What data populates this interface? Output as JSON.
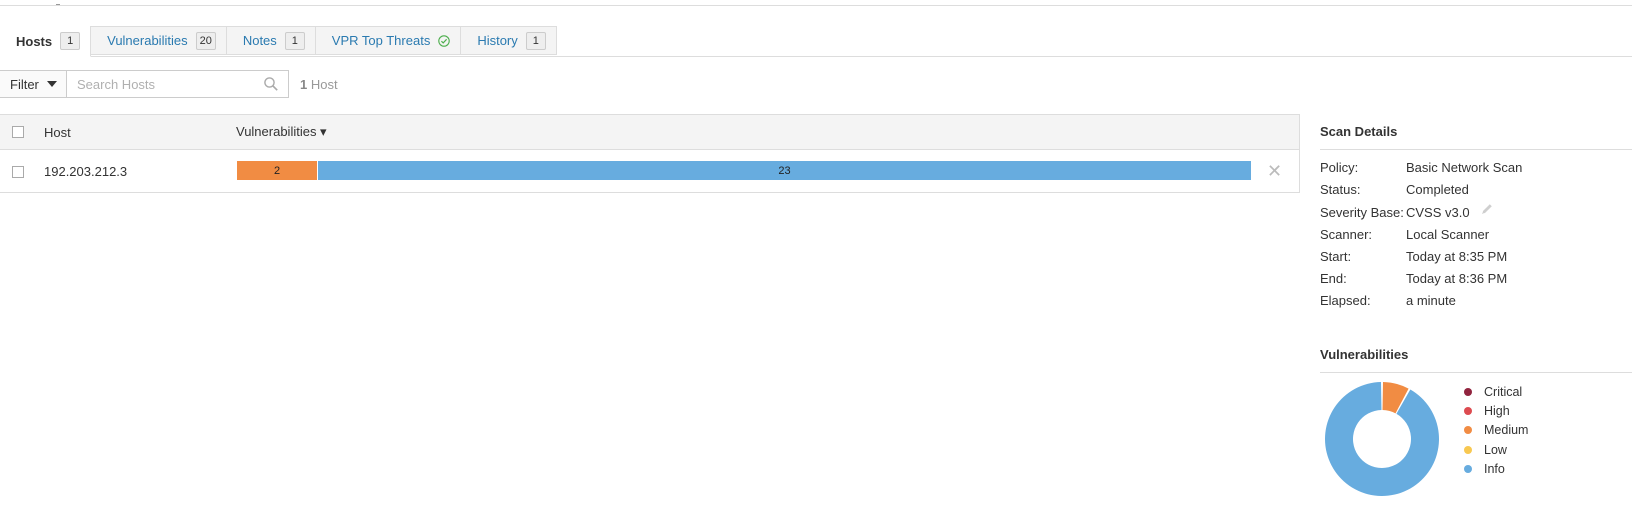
{
  "tabs": [
    {
      "label": "Hosts",
      "badge": "1",
      "active": true
    },
    {
      "label": "Vulnerabilities",
      "badge": "20"
    },
    {
      "label": "Notes",
      "badge": "1"
    },
    {
      "label": "VPR Top Threats",
      "icon": "check-circle-icon"
    },
    {
      "label": "History",
      "badge": "1"
    }
  ],
  "filter": {
    "button_label": "Filter",
    "search_placeholder": "Search Hosts",
    "count_number": "1",
    "count_label": "Host"
  },
  "table": {
    "columns": {
      "host": "Host",
      "vulnerabilities": "Vulnerabilities ▾"
    },
    "rows": [
      {
        "host": "192.203.212.3",
        "medium": 2,
        "info": 23,
        "medium_label": "2",
        "info_label": "23"
      }
    ]
  },
  "scan_details": {
    "title": "Scan Details",
    "items": [
      {
        "key": "Policy:",
        "value": "Basic Network Scan"
      },
      {
        "key": "Status:",
        "value": "Completed"
      },
      {
        "key": "Severity Base:",
        "value": "CVSS v3.0"
      },
      {
        "key": "Scanner:",
        "value": "Local Scanner"
      },
      {
        "key": "Start:",
        "value": "Today at 8:35 PM"
      },
      {
        "key": "End:",
        "value": "Today at 8:36 PM"
      },
      {
        "key": "Elapsed:",
        "value": "a minute"
      }
    ]
  },
  "vulnerabilities_panel": {
    "title": "Vulnerabilities",
    "legend": [
      {
        "label": "Critical",
        "color": "#91243e"
      },
      {
        "label": "High",
        "color": "#dd4b50"
      },
      {
        "label": "Medium",
        "color": "#f18c43"
      },
      {
        "label": "Low",
        "color": "#f8c851"
      },
      {
        "label": "Info",
        "color": "#67acdf"
      }
    ]
  },
  "chart_data": {
    "type": "pie",
    "categories": [
      "Critical",
      "High",
      "Medium",
      "Low",
      "Info"
    ],
    "values": [
      0,
      0,
      2,
      0,
      23
    ]
  },
  "colors": {
    "link": "#2a7ab0",
    "medium": "#f18c43",
    "info": "#67acdf",
    "success": "#4cae4c"
  }
}
